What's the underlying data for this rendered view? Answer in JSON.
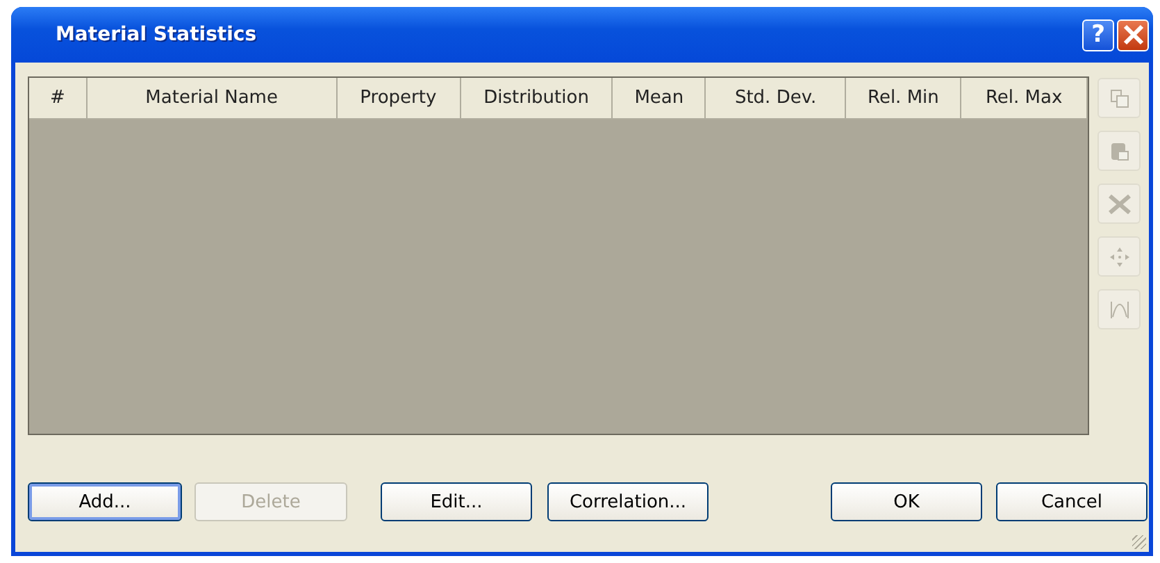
{
  "window": {
    "title": "Material Statistics",
    "help": "?"
  },
  "table": {
    "columns": [
      "#",
      "Material Name",
      "Property",
      "Distribution",
      "Mean",
      "Std. Dev.",
      "Rel. Min",
      "Rel. Max"
    ]
  },
  "side_tools": [
    {
      "kind": "copy",
      "disabled": true
    },
    {
      "kind": "paste",
      "disabled": true
    },
    {
      "kind": "excel",
      "disabled": true
    },
    {
      "kind": "move",
      "disabled": true
    },
    {
      "kind": "chart",
      "disabled": true
    }
  ],
  "buttons": [
    {
      "label": "Add...",
      "disabled": false,
      "selected": true
    },
    {
      "label": "Delete",
      "disabled": true,
      "selected": false
    },
    {
      "label": "Edit...",
      "disabled": false,
      "selected": false
    },
    {
      "label": "Correlation...",
      "disabled": false,
      "selected": false
    },
    {
      "label": "OK",
      "disabled": false,
      "selected": false
    },
    {
      "label": "Cancel",
      "disabled": false,
      "selected": false
    }
  ]
}
